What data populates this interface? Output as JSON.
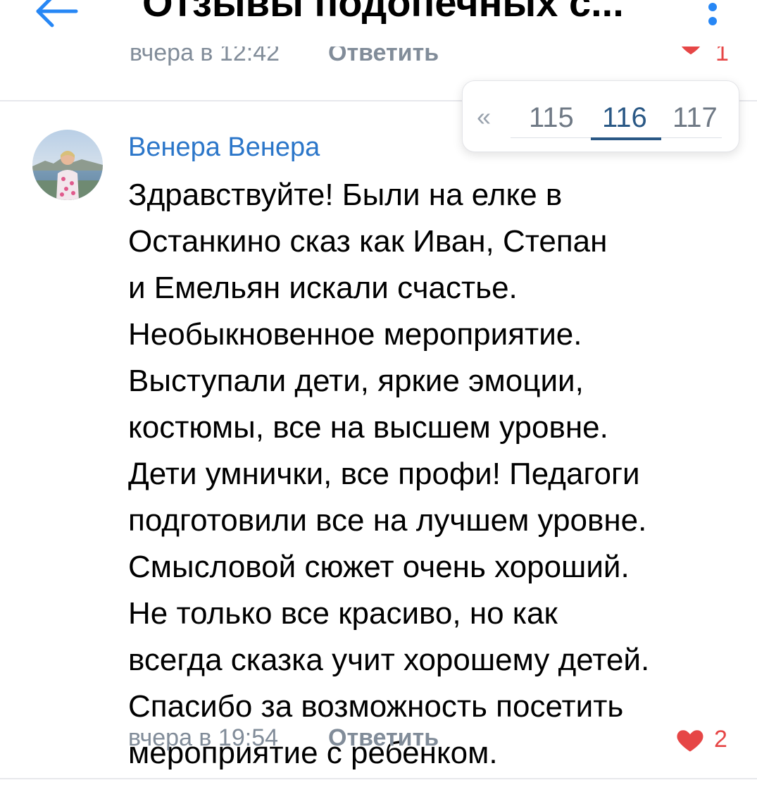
{
  "header": {
    "title": "Отзывы подопечных с...",
    "back_icon": "arrow-left-icon",
    "more_icon": "more-vertical-icon",
    "accent": "#2787f5"
  },
  "previous_comment": {
    "time": "вчера в 12:42",
    "reply_label": "Ответить",
    "likes": "1"
  },
  "pagination": {
    "prev": "«",
    "pages": [
      "115",
      "116",
      "117"
    ],
    "current": "116"
  },
  "comment": {
    "author": "Венера Венера",
    "lines": [
      "Здравствуйте! Были на елке в",
      "Останкино сказ как Иван, Степан",
      "и Емельян искали счастье.",
      "Необыкновенное мероприятие.",
      "Выступали дети, яркие эмоции,",
      "костюмы, все на высшем уровне.",
      "Дети умнички, все профи! Педагоги",
      "подготовили все на лучшем уровне.",
      "Смысловой сюжет очень хороший.",
      "Не только все красиво, но как",
      "всегда сказка учит хорошему детей.",
      "Спасибо за возможность посетить",
      "мероприятие с ребенком."
    ],
    "time": "вчера в 19:54",
    "reply_label": "Ответить",
    "likes": "2",
    "heart_color": "#e64646",
    "author_color": "#2b76c9"
  }
}
